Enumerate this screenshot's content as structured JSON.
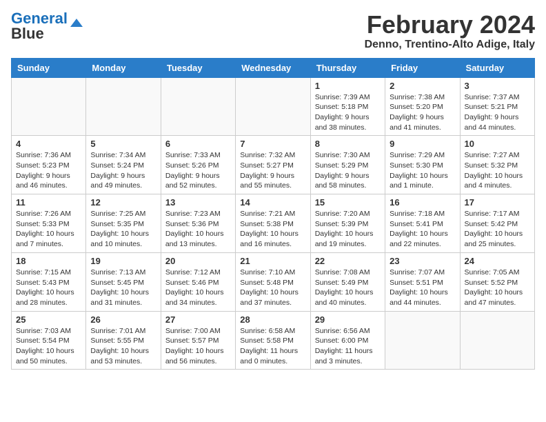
{
  "header": {
    "logo_line1": "General",
    "logo_line2": "Blue",
    "month_title": "February 2024",
    "location": "Denno, Trentino-Alto Adige, Italy"
  },
  "weekdays": [
    "Sunday",
    "Monday",
    "Tuesday",
    "Wednesday",
    "Thursday",
    "Friday",
    "Saturday"
  ],
  "weeks": [
    [
      {
        "day": "",
        "info": ""
      },
      {
        "day": "",
        "info": ""
      },
      {
        "day": "",
        "info": ""
      },
      {
        "day": "",
        "info": ""
      },
      {
        "day": "1",
        "info": "Sunrise: 7:39 AM\nSunset: 5:18 PM\nDaylight: 9 hours\nand 38 minutes."
      },
      {
        "day": "2",
        "info": "Sunrise: 7:38 AM\nSunset: 5:20 PM\nDaylight: 9 hours\nand 41 minutes."
      },
      {
        "day": "3",
        "info": "Sunrise: 7:37 AM\nSunset: 5:21 PM\nDaylight: 9 hours\nand 44 minutes."
      }
    ],
    [
      {
        "day": "4",
        "info": "Sunrise: 7:36 AM\nSunset: 5:23 PM\nDaylight: 9 hours\nand 46 minutes."
      },
      {
        "day": "5",
        "info": "Sunrise: 7:34 AM\nSunset: 5:24 PM\nDaylight: 9 hours\nand 49 minutes."
      },
      {
        "day": "6",
        "info": "Sunrise: 7:33 AM\nSunset: 5:26 PM\nDaylight: 9 hours\nand 52 minutes."
      },
      {
        "day": "7",
        "info": "Sunrise: 7:32 AM\nSunset: 5:27 PM\nDaylight: 9 hours\nand 55 minutes."
      },
      {
        "day": "8",
        "info": "Sunrise: 7:30 AM\nSunset: 5:29 PM\nDaylight: 9 hours\nand 58 minutes."
      },
      {
        "day": "9",
        "info": "Sunrise: 7:29 AM\nSunset: 5:30 PM\nDaylight: 10 hours\nand 1 minute."
      },
      {
        "day": "10",
        "info": "Sunrise: 7:27 AM\nSunset: 5:32 PM\nDaylight: 10 hours\nand 4 minutes."
      }
    ],
    [
      {
        "day": "11",
        "info": "Sunrise: 7:26 AM\nSunset: 5:33 PM\nDaylight: 10 hours\nand 7 minutes."
      },
      {
        "day": "12",
        "info": "Sunrise: 7:25 AM\nSunset: 5:35 PM\nDaylight: 10 hours\nand 10 minutes."
      },
      {
        "day": "13",
        "info": "Sunrise: 7:23 AM\nSunset: 5:36 PM\nDaylight: 10 hours\nand 13 minutes."
      },
      {
        "day": "14",
        "info": "Sunrise: 7:21 AM\nSunset: 5:38 PM\nDaylight: 10 hours\nand 16 minutes."
      },
      {
        "day": "15",
        "info": "Sunrise: 7:20 AM\nSunset: 5:39 PM\nDaylight: 10 hours\nand 19 minutes."
      },
      {
        "day": "16",
        "info": "Sunrise: 7:18 AM\nSunset: 5:41 PM\nDaylight: 10 hours\nand 22 minutes."
      },
      {
        "day": "17",
        "info": "Sunrise: 7:17 AM\nSunset: 5:42 PM\nDaylight: 10 hours\nand 25 minutes."
      }
    ],
    [
      {
        "day": "18",
        "info": "Sunrise: 7:15 AM\nSunset: 5:43 PM\nDaylight: 10 hours\nand 28 minutes."
      },
      {
        "day": "19",
        "info": "Sunrise: 7:13 AM\nSunset: 5:45 PM\nDaylight: 10 hours\nand 31 minutes."
      },
      {
        "day": "20",
        "info": "Sunrise: 7:12 AM\nSunset: 5:46 PM\nDaylight: 10 hours\nand 34 minutes."
      },
      {
        "day": "21",
        "info": "Sunrise: 7:10 AM\nSunset: 5:48 PM\nDaylight: 10 hours\nand 37 minutes."
      },
      {
        "day": "22",
        "info": "Sunrise: 7:08 AM\nSunset: 5:49 PM\nDaylight: 10 hours\nand 40 minutes."
      },
      {
        "day": "23",
        "info": "Sunrise: 7:07 AM\nSunset: 5:51 PM\nDaylight: 10 hours\nand 44 minutes."
      },
      {
        "day": "24",
        "info": "Sunrise: 7:05 AM\nSunset: 5:52 PM\nDaylight: 10 hours\nand 47 minutes."
      }
    ],
    [
      {
        "day": "25",
        "info": "Sunrise: 7:03 AM\nSunset: 5:54 PM\nDaylight: 10 hours\nand 50 minutes."
      },
      {
        "day": "26",
        "info": "Sunrise: 7:01 AM\nSunset: 5:55 PM\nDaylight: 10 hours\nand 53 minutes."
      },
      {
        "day": "27",
        "info": "Sunrise: 7:00 AM\nSunset: 5:57 PM\nDaylight: 10 hours\nand 56 minutes."
      },
      {
        "day": "28",
        "info": "Sunrise: 6:58 AM\nSunset: 5:58 PM\nDaylight: 11 hours\nand 0 minutes."
      },
      {
        "day": "29",
        "info": "Sunrise: 6:56 AM\nSunset: 6:00 PM\nDaylight: 11 hours\nand 3 minutes."
      },
      {
        "day": "",
        "info": ""
      },
      {
        "day": "",
        "info": ""
      }
    ]
  ]
}
